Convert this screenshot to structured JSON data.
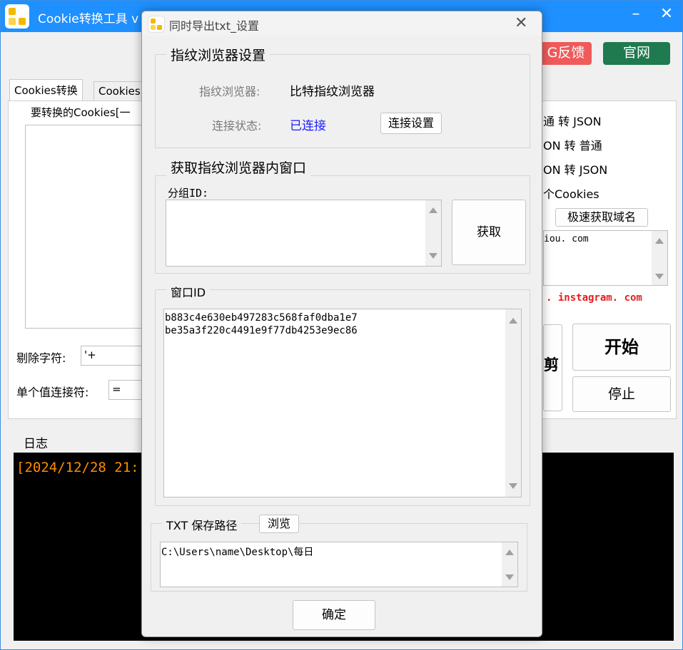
{
  "main": {
    "title": "Cookie转换工具 v",
    "feedback_label": "G反馈",
    "website_label": "官网",
    "tabs": [
      "Cookies转换",
      "Cookies"
    ],
    "convert_group_title": "要转换的Cookies[一",
    "convert_options": [
      "通 转 JSON",
      "ON 转 普通",
      "ON 转 JSON",
      "个Cookies"
    ],
    "fast_domain_label": "极速获取域名",
    "domain_text": "iou. com",
    "instagram_text": ". instagram. com",
    "cut_label": "剪",
    "start_label": "开始",
    "stop_label": "停止",
    "strip_label": "剔除字符:",
    "strip_value": "'+",
    "joiner_label": "单个值连接符:",
    "joiner_value": "=",
    "log_title": "日志",
    "log_text": "[2024/12/28 21:"
  },
  "dialog": {
    "title": "同时导出txt_设置",
    "fp_group_title": "指纹浏览器设置",
    "fp_browser_label": "指纹浏览器:",
    "fp_browser_value": "比特指纹浏览器",
    "conn_status_label": "连接状态:",
    "conn_status_value": "已连接",
    "conn_settings_button": "连接设置",
    "fetch_group_title": "获取指纹浏览器内窗口",
    "group_id_label": "分组ID:",
    "group_id_value": "",
    "fetch_button": "获取",
    "window_id_group_title": "窗口ID",
    "window_ids": [
      "b883c4e630eb497283c568faf0dba1e7",
      "be35a3f220c4491e9f77db4253e9ec86"
    ],
    "save_group_title": "TXT 保存路径",
    "browse_button": "浏览",
    "save_path": "C:\\Users\\name\\Desktop\\每日",
    "ok_button": "确定"
  },
  "colors": {
    "titlebar": "#1e90ff",
    "feedback": "#f05a5a",
    "website": "#1f7a4f",
    "connected": "#1a1aff",
    "log_text": "#ff8c00",
    "domain_red": "#e02020"
  }
}
